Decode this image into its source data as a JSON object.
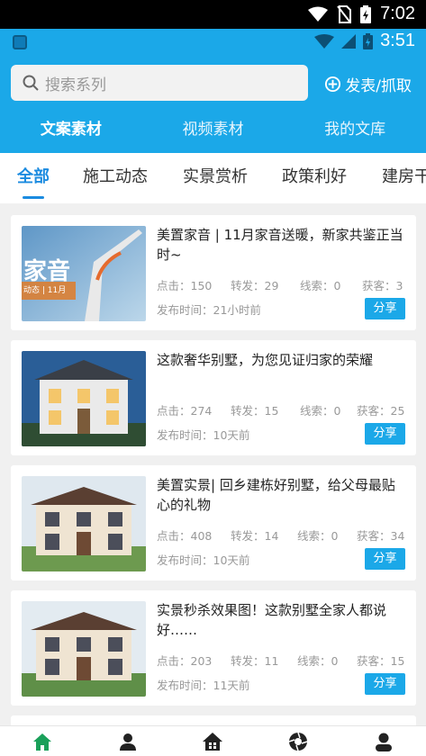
{
  "system": {
    "time": "7:02"
  },
  "app_status": {
    "time": "3:51"
  },
  "header": {
    "search_placeholder": "搜索系列",
    "publish_label": "发表/抓取",
    "tabs": [
      "文案素材",
      "视频素材",
      "我的文库"
    ],
    "active_tab": 0
  },
  "categories": {
    "items": [
      "全部",
      "施工动态",
      "实景赏析",
      "政策利好",
      "建房干"
    ],
    "active": 0
  },
  "articles": [
    {
      "title": "美置家音 | 11月家音送暖，新家共鉴正当时~",
      "views": "点击：150",
      "shares": "转发：29",
      "leads": "线索：0",
      "customers": "获客：3",
      "time": "发布时间：21小时前",
      "thumb_text": "家音",
      "thumb_sub": "动态 | 11月"
    },
    {
      "title": "这款奢华别墅，为您见证归家的荣耀",
      "views": "点击：274",
      "shares": "转发：15",
      "leads": "线索：0",
      "customers": "获客：25",
      "time": "发布时间：10天前"
    },
    {
      "title": "美置实景| 回乡建栋好别墅，给父母最贴心的礼物",
      "views": "点击：408",
      "shares": "转发：14",
      "leads": "线索：0",
      "customers": "获客：34",
      "time": "发布时间：10天前"
    },
    {
      "title": "实景秒杀效果图！这款别墅全家人都说好……",
      "views": "点击：203",
      "shares": "转发：11",
      "leads": "线索：0",
      "customers": "获客：15",
      "time": "发布时间：11天前"
    }
  ],
  "share_label": "分享",
  "bottom_nav": [
    {
      "icon": "home-icon",
      "active": true
    },
    {
      "icon": "person-icon",
      "active": false
    },
    {
      "icon": "house-icon",
      "active": false
    },
    {
      "icon": "aperture-icon",
      "active": false
    },
    {
      "icon": "profile-icon",
      "active": false
    }
  ],
  "colors": {
    "primary": "#1ba8e8",
    "active_tab": "#1b8be0",
    "nav_active": "#1aa05a",
    "nav_inactive": "#222222"
  }
}
